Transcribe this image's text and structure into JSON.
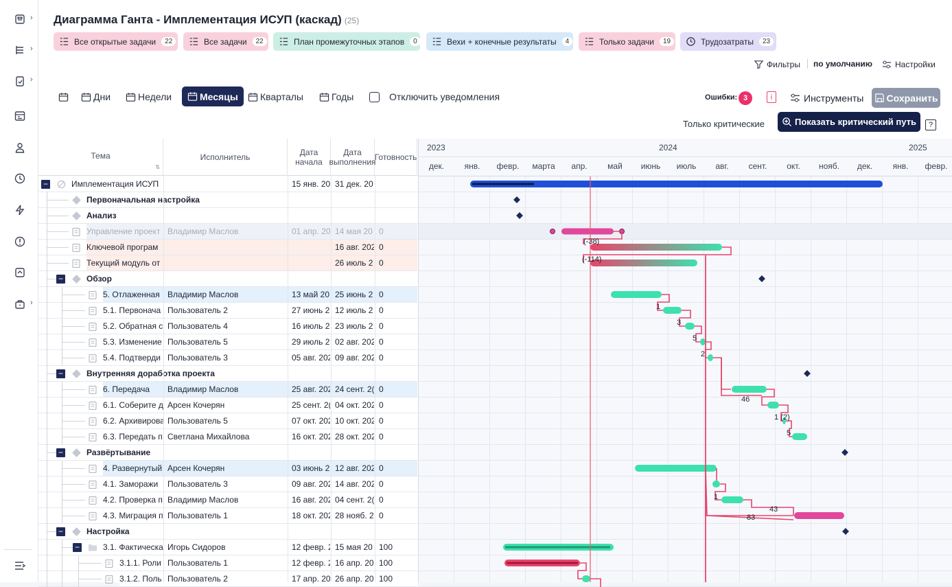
{
  "title": "Диаграмма Ганта - Имплементация ИСУП (каскад)",
  "title_count": "(25)",
  "chips": [
    {
      "label": "Все открытые задачи",
      "count": "22",
      "icon": "open-tasks-icon",
      "bg": "#f9d1dc"
    },
    {
      "label": "Все задачи",
      "count": "22",
      "icon": "list-icon",
      "bg": "#f9d1dc"
    },
    {
      "label": "План промежуточных этапов",
      "count": "0",
      "icon": "plan-icon",
      "bg": "#cdeee4"
    },
    {
      "label": "Вехи + конечные результаты",
      "count": "4",
      "icon": "milestones-icon",
      "bg": "#d5e9f8"
    },
    {
      "label": "Только задачи",
      "count": "19",
      "icon": "list-icon",
      "bg": "#f9d1dc"
    },
    {
      "label": "Трудозатраты",
      "count": "23",
      "icon": "clock-icon",
      "bg": "#e1dcf7"
    }
  ],
  "toolbar": {
    "filters": "Фильтры",
    "default": "по умолчанию",
    "settings": "Настройки",
    "errors_label": "Ошибки:",
    "errors_count": "3",
    "tools": "Инструменты",
    "save": "Сохранить",
    "critical_only": "Только критические",
    "show_critical": "Показать критический путь",
    "help": "?"
  },
  "scales": [
    "Дни",
    "Недели",
    "Месяцы",
    "Кварталы",
    "Годы"
  ],
  "active_scale": "Месяцы",
  "notify_label": "Отключить уведомления",
  "columns": [
    "Тема",
    "Исполнитель",
    "Дата начала",
    "Дата выполнения",
    "Готовность"
  ],
  "years": [
    "2023",
    "2024",
    "2025"
  ],
  "months": [
    "дек.",
    "янв.",
    "февр.",
    "марта",
    "апр.",
    "май",
    "июнь",
    "июль",
    "авг.",
    "сент.",
    "окт.",
    "нояб.",
    "дек.",
    "янв.",
    "февр."
  ],
  "rows": [
    {
      "level": 0,
      "toggle": "−",
      "type": "group",
      "topic": "Имплементация ИСУП",
      "assignee": "",
      "start": "15 янв. 20",
      "end": "31 дек. 20",
      "ready": "",
      "bold": false,
      "bg": "#fff"
    },
    {
      "level": 1,
      "toggle": "",
      "type": "milestone",
      "topic": "Первоначальная настройка",
      "assignee": "",
      "start": "",
      "end": "",
      "ready": "",
      "bold": true,
      "bg": "#fff"
    },
    {
      "level": 1,
      "toggle": "",
      "type": "milestone",
      "topic": "Анализ",
      "assignee": "",
      "start": "",
      "end": "",
      "ready": "",
      "bold": true,
      "bg": "#fff"
    },
    {
      "level": 1,
      "toggle": "",
      "type": "task",
      "topic": "Управление проект",
      "assignee": "Владимир Маслов",
      "start": "01 апр. 20",
      "end": "14 мая 20",
      "ready": "0",
      "bold": false,
      "bg": "#eef2f8",
      "muted": true
    },
    {
      "level": 1,
      "toggle": "",
      "type": "task",
      "topic": "Ключевой програм",
      "assignee": "",
      "start": "",
      "end": "16 авг. 202",
      "ready": "0",
      "bold": false,
      "bg": "#fdeeea"
    },
    {
      "level": 1,
      "toggle": "",
      "type": "task",
      "topic": "Текущий модуль от",
      "assignee": "",
      "start": "",
      "end": "26 июль 2",
      "ready": "0",
      "bold": false,
      "bg": "#fdeeea"
    },
    {
      "level": 1,
      "toggle": "−",
      "type": "milestone",
      "topic": "Обзор",
      "assignee": "",
      "start": "",
      "end": "",
      "ready": "",
      "bold": true,
      "bg": "#fff"
    },
    {
      "level": 2,
      "toggle": "",
      "type": "task",
      "topic": "5. Отлаженная",
      "assignee": "Владимир Маслов",
      "start": "13 май 20",
      "end": "25 июнь 2",
      "ready": "0",
      "bold": false,
      "bg": "#e4f0fb"
    },
    {
      "level": 2,
      "toggle": "",
      "type": "task",
      "topic": "5.1. Первонача",
      "assignee": "Пользователь 2",
      "start": "27 июнь 2",
      "end": "12 июль 2",
      "ready": "0",
      "bold": false,
      "bg": "#fff"
    },
    {
      "level": 2,
      "toggle": "",
      "type": "task",
      "topic": "5.2. Обратная с",
      "assignee": "Пользователь 4",
      "start": "16 июль 2",
      "end": "23 июль 2",
      "ready": "0",
      "bold": false,
      "bg": "#fff"
    },
    {
      "level": 2,
      "toggle": "",
      "type": "task",
      "topic": "5.3. Изменение",
      "assignee": "Пользователь 5",
      "start": "29 июль 2",
      "end": "02 авг. 202",
      "ready": "0",
      "bold": false,
      "bg": "#fff"
    },
    {
      "level": 2,
      "toggle": "",
      "type": "task",
      "topic": "5.4. Подтверди",
      "assignee": "Пользователь 3",
      "start": "05 авг. 202",
      "end": "09 авг. 202",
      "ready": "0",
      "bold": false,
      "bg": "#fff"
    },
    {
      "level": 1,
      "toggle": "−",
      "type": "milestone",
      "topic": "Внутренняя доработка проекта",
      "assignee": "",
      "start": "",
      "end": "",
      "ready": "",
      "bold": true,
      "bg": "#fff"
    },
    {
      "level": 2,
      "toggle": "",
      "type": "task",
      "topic": "6. Передача",
      "assignee": "Владимир Маслов",
      "start": "25 авг. 202",
      "end": "24 сент. 2(",
      "ready": "0",
      "bold": false,
      "bg": "#e4f0fb"
    },
    {
      "level": 2,
      "toggle": "",
      "type": "task",
      "topic": "6.1. Соберите д",
      "assignee": "Арсен Кочерян",
      "start": "25 сент. 2(",
      "end": "04 окт. 202",
      "ready": "0",
      "bold": false,
      "bg": "#fff"
    },
    {
      "level": 2,
      "toggle": "",
      "type": "task",
      "topic": "6.2. Архивирова",
      "assignee": "Пользователь 5",
      "start": "07 окт. 202",
      "end": "10 окт. 202",
      "ready": "0",
      "bold": false,
      "bg": "#fff"
    },
    {
      "level": 2,
      "toggle": "",
      "type": "task",
      "topic": "6.3. Передать п",
      "assignee": "Светлана Михайлова",
      "start": "16 окт. 202",
      "end": "28 окт. 202",
      "ready": "0",
      "bold": false,
      "bg": "#fff"
    },
    {
      "level": 1,
      "toggle": "−",
      "type": "milestone",
      "topic": "Развёртывание",
      "assignee": "",
      "start": "",
      "end": "",
      "ready": "",
      "bold": true,
      "bg": "#fff"
    },
    {
      "level": 2,
      "toggle": "",
      "type": "task",
      "topic": "4. Развернутый",
      "assignee": "Арсен Кочерян",
      "start": "03 июнь 2",
      "end": "12 авг. 202",
      "ready": "0",
      "bold": false,
      "bg": "#e4f0fb"
    },
    {
      "level": 2,
      "toggle": "",
      "type": "task",
      "topic": "4.1. Заморажи",
      "assignee": "Пользователь 3",
      "start": "09 авг. 202",
      "end": "14 авг. 202",
      "ready": "0",
      "bold": false,
      "bg": "#fff"
    },
    {
      "level": 2,
      "toggle": "",
      "type": "task",
      "topic": "4.2. Проверка п",
      "assignee": "Владимир Маслов",
      "start": "16 авг. 202",
      "end": "04 сент. 2(",
      "ready": "0",
      "bold": false,
      "bg": "#fff"
    },
    {
      "level": 2,
      "toggle": "",
      "type": "task",
      "topic": "4.3. Миграция п",
      "assignee": "Пользователь 1",
      "start": "18 окт. 202",
      "end": "28 нояб. 2",
      "ready": "0",
      "bold": false,
      "bg": "#fff"
    },
    {
      "level": 1,
      "toggle": "−",
      "type": "milestone",
      "topic": "Настройка",
      "assignee": "",
      "start": "",
      "end": "",
      "ready": "",
      "bold": true,
      "bg": "#fff"
    },
    {
      "level": 2,
      "toggle": "−",
      "type": "folder",
      "topic": "3.1. Фактическа",
      "assignee": "Игорь Сидоров",
      "start": "12 февр. 2",
      "end": "15 мая 20",
      "ready": "100",
      "bold": false,
      "bg": "#fff"
    },
    {
      "level": 3,
      "toggle": "",
      "type": "task",
      "topic": "3.1.1. Роли",
      "assignee": "Пользователь 1",
      "start": "12 февр. 2",
      "end": "16 апр. 20",
      "ready": "100",
      "bold": false,
      "bg": "#fff"
    },
    {
      "level": 3,
      "toggle": "",
      "type": "task",
      "topic": "3.1.2. Поль",
      "assignee": "Пользователь 2",
      "start": "17 апр. 20",
      "end": "26 апр. 20",
      "ready": "100",
      "bold": false,
      "bg": "#fff"
    }
  ],
  "link_labels": [
    "(-38)",
    "(-114)",
    "1",
    "3",
    "5",
    "2",
    "46",
    "1 (2)",
    "5",
    "1",
    "43",
    "83"
  ],
  "colors": {
    "accent": "#1d2a57",
    "green": "#3ee0ad",
    "pink": "#e1479b",
    "red": "#e8456b",
    "blue": "#1f4fd6"
  }
}
